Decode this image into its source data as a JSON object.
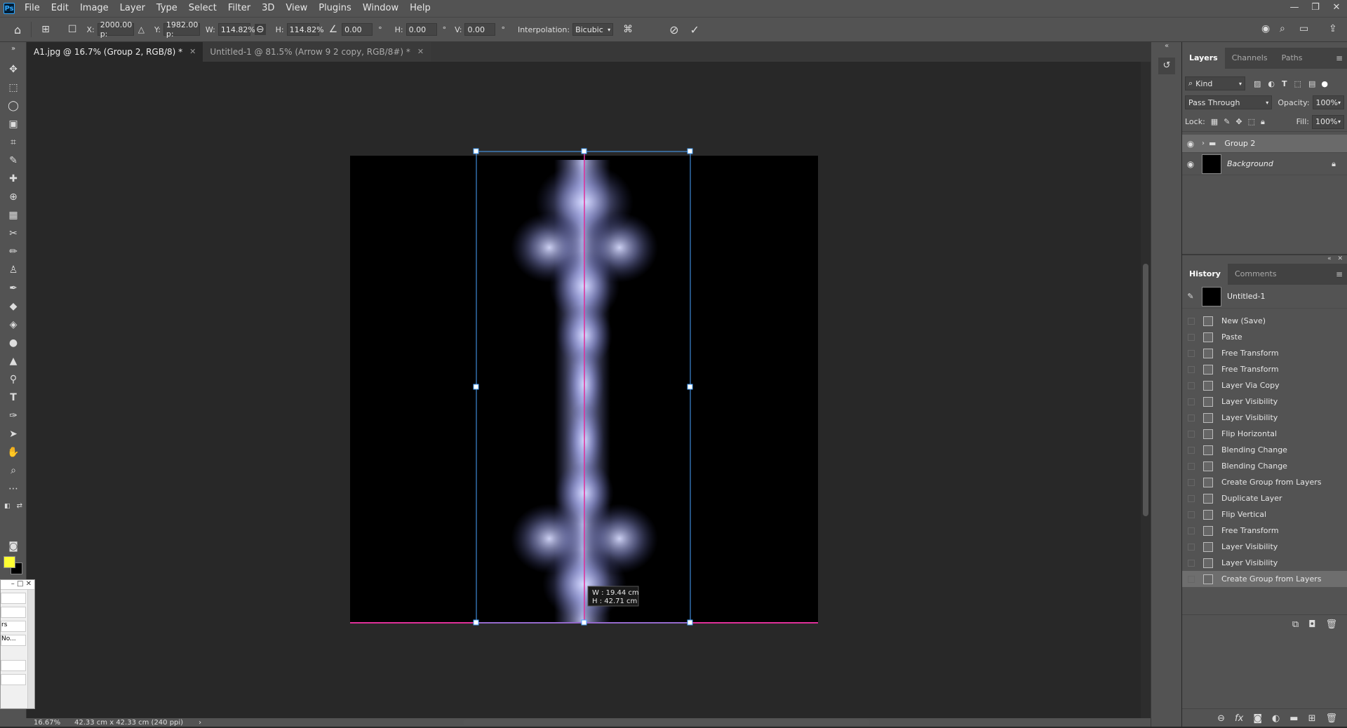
{
  "menubar": {
    "logo": "Ps",
    "items": [
      "File",
      "Edit",
      "Image",
      "Layer",
      "Type",
      "Select",
      "Filter",
      "3D",
      "View",
      "Plugins",
      "Window",
      "Help"
    ],
    "window_controls": [
      "—",
      "❐",
      "✕"
    ]
  },
  "options": {
    "x_label": "X:",
    "x_value": "2000.00 p:",
    "y_label": "Y:",
    "y_value": "1982.00 p:",
    "w_label": "W:",
    "w_value": "114.82%",
    "h_label": "H:",
    "h_value": "114.82%",
    "angle_value": "0.00",
    "degree": "°",
    "hskew_label": "H:",
    "hskew_value": "0.00",
    "vskew_label": "V:",
    "vskew_value": "0.00",
    "interp_label": "Interpolation:",
    "interp_value": "Bicubic"
  },
  "tabs": [
    {
      "label": "A1.jpg @ 16.7% (Group 2, RGB/8) *"
    },
    {
      "label": "Untitled-1 @ 81.5% (Arrow 9 2 copy, RGB/8#) *"
    }
  ],
  "canvas": {
    "size_w": "W :  19.44 cm",
    "size_h": "H :  42.71 cm"
  },
  "status": {
    "zoom": "16.67%",
    "doc_size": "42.33 cm x 42.33 cm (240 ppi)"
  },
  "floatwin": {
    "rows": [
      "",
      "",
      "rs",
      "No...",
      "",
      ""
    ]
  },
  "layers_panel": {
    "tabs": [
      "Layers",
      "Channels",
      "Paths"
    ],
    "filter": "Kind",
    "blend_mode": "Pass Through",
    "opacity_label": "Opacity:",
    "opacity_value": "100%",
    "lock_label": "Lock:",
    "fill_label": "Fill:",
    "fill_value": "100%",
    "layers": [
      {
        "name": "Group 2"
      },
      {
        "name": "Background"
      }
    ]
  },
  "history_panel": {
    "tabs": [
      "History",
      "Comments"
    ],
    "snapshot": "Untitled-1",
    "items": [
      "New (Save)",
      "Paste",
      "Free Transform",
      "Free Transform",
      "Layer Via Copy",
      "Layer Visibility",
      "Layer Visibility",
      "Flip Horizontal",
      "Blending Change",
      "Blending Change",
      "Create Group from Layers",
      "Duplicate Layer",
      "Flip Vertical",
      "Free Transform",
      "Layer Visibility",
      "Layer Visibility",
      "Create Group from Layers"
    ]
  },
  "colors": {
    "foreground": "#ffff33",
    "background": "#000000",
    "accent": "#31a8ff",
    "guide": "#e0309a"
  }
}
